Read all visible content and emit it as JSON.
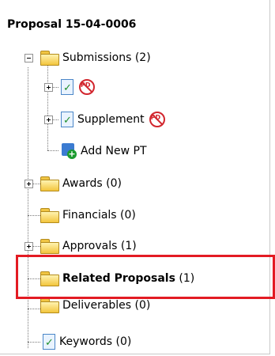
{
  "tree": {
    "root_label": "Proposal 15-04-0006",
    "submissions": {
      "label": "Submissions",
      "count": "(2)",
      "children": [
        {
          "label": "",
          "icon": "document-check-icon",
          "badge": "no-pd-icon"
        },
        {
          "label": "Supplement",
          "icon": "document-check-icon",
          "badge": "no-pd-icon"
        },
        {
          "label": "Add New PT",
          "icon": "add-new-pt-icon"
        }
      ]
    },
    "awards": {
      "label": "Awards (0)"
    },
    "financials": {
      "label": "Financials (0)"
    },
    "approvals": {
      "label": "Approvals (1)"
    },
    "related_proposals": {
      "label": "Related Proposals",
      "count": "(1)"
    },
    "deliverables": {
      "label": "Deliverables (0)"
    },
    "keywords": {
      "label": "Keywords (0)"
    }
  },
  "icon_text": {
    "no_pd": "PD"
  },
  "colors": {
    "highlight": "#e31b23",
    "folder": "#f3c53d",
    "link_blue": "#3b7bd1"
  }
}
